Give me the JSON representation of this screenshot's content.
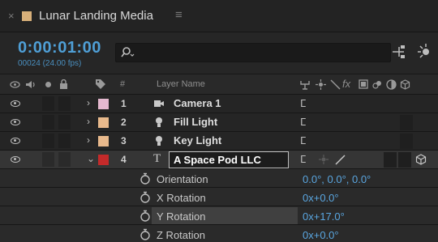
{
  "panel": {
    "close_glyph": "×",
    "title": "Lunar Landing Media",
    "menu_glyph": "≡",
    "swatch_color": "#d8b07a"
  },
  "toolbar": {
    "timecode": "0:00:01:00",
    "frames": "00024 (24.00 fps)",
    "search_placeholder": "",
    "icons": [
      "search-icon",
      "composition-flowchart-icon",
      "draft-3d-icon"
    ]
  },
  "columns": {
    "header_icons": [
      "eye-icon",
      "audio-icon",
      "solo-icon",
      "lock-icon",
      "label-tag-icon"
    ],
    "number_header": "#",
    "name_header": "Layer Name",
    "fx_glyph": "fx"
  },
  "layers": [
    {
      "number": "1",
      "name": "Camera 1",
      "type_icon": "camera-icon",
      "label_color": "#e4b8cf",
      "expanded": false,
      "chevron": "›",
      "parent_glyph": "ⵎ"
    },
    {
      "number": "2",
      "name": "Fill Light",
      "type_icon": "light-bulb-icon",
      "label_color": "#e8b98c",
      "expanded": false,
      "chevron": "›",
      "parent_glyph": "ⵎ"
    },
    {
      "number": "3",
      "name": "Key  Light",
      "type_icon": "light-bulb-icon",
      "label_color": "#e8b98c",
      "expanded": false,
      "chevron": "›",
      "parent_glyph": "ⵎ"
    },
    {
      "number": "4",
      "name": "A Space Pod LLC",
      "type_icon": "text-layer-icon",
      "type_glyph": "T",
      "label_color": "#c42a2a",
      "expanded": true,
      "chevron": "⌄",
      "parent_glyph": "ⵎ"
    }
  ],
  "properties": [
    {
      "name": "Orientation",
      "value": "0.0°, 0.0°, 0.0°",
      "highlighted": false
    },
    {
      "name": "X Rotation",
      "value": "0x+0.0°",
      "highlighted": false
    },
    {
      "name": "Y Rotation",
      "value": "0x+17.0°",
      "highlighted": true
    },
    {
      "name": "Z Rotation",
      "value": "0x+0.0°",
      "highlighted": false
    }
  ],
  "colors": {
    "accent": "#4f9fd6",
    "value_blue": "#5aa6e0",
    "panel_bg": "#252525"
  }
}
